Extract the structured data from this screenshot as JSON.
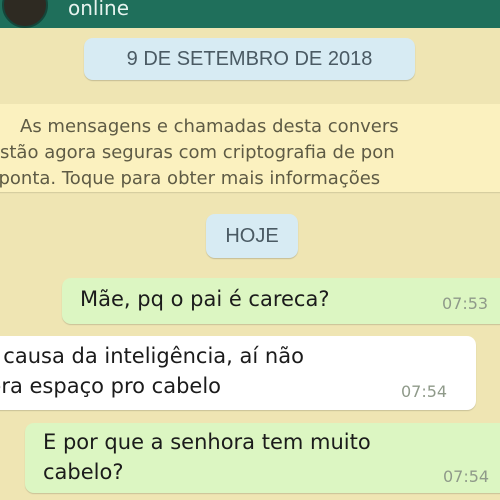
{
  "header": {
    "status": "online",
    "colors": {
      "bar": "#1f6f5b"
    }
  },
  "date_divider": "9 DE SETEMBRO DE 2018",
  "encryption_notice": {
    "icon": "lock-icon",
    "lines": [
      "As mensagens e chamadas desta convers",
      "stão agora seguras com criptografia de pon",
      "-ponta. Toque para obter mais informações"
    ]
  },
  "today_divider": "HOJE",
  "messages": [
    {
      "direction": "outgoing",
      "lines": [
        "Mãe, pq o pai é careca?"
      ],
      "time": "07:53"
    },
    {
      "direction": "incoming",
      "lines": [
        "r causa da inteligência, aí não",
        "bra espaço pro cabelo"
      ],
      "time": "07:54"
    },
    {
      "direction": "outgoing",
      "lines": [
        "E por que a senhora tem muito",
        "cabelo?"
      ],
      "time": "07:54"
    }
  ],
  "colors": {
    "wallpaper": "#efe5b3",
    "outgoing_bubble": "#dcf6c2",
    "incoming_bubble": "#ffffff",
    "date_chip": "#d7ebf3",
    "notice_bg": "#fbf1bf"
  }
}
